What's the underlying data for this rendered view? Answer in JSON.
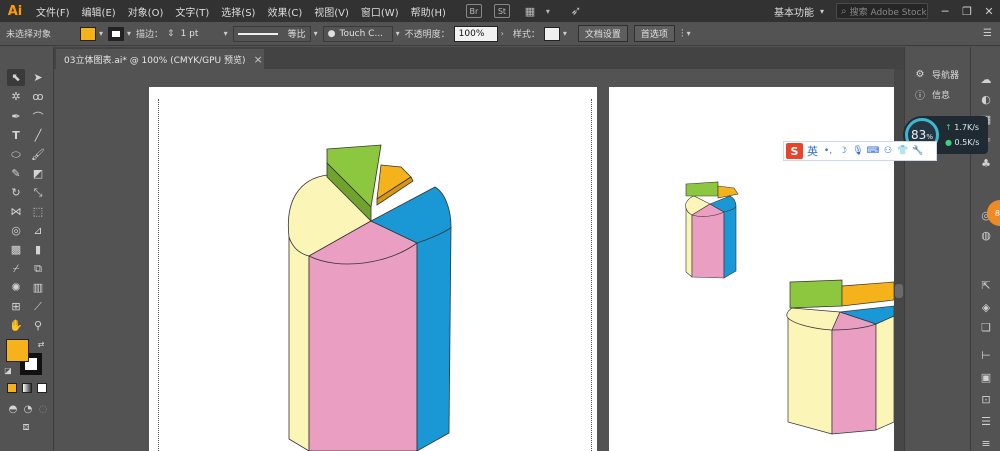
{
  "app": {
    "logo": "Ai"
  },
  "menu": [
    "文件(F)",
    "编辑(E)",
    "对象(O)",
    "文字(T)",
    "选择(S)",
    "效果(C)",
    "视图(V)",
    "窗口(W)",
    "帮助(H)"
  ],
  "menu_icons": {
    "bridge": "Br",
    "stock": "St"
  },
  "workspace": {
    "label": "基本功能",
    "search_placeholder": "搜索 Adobe Stock"
  },
  "control_bar": {
    "selection_status": "未选择对象",
    "fill_color": "#f5b21a",
    "stroke_label": "描边：",
    "stroke_weight": "1 pt",
    "profile": "等比",
    "brush": "Touch C...",
    "opacity_label": "不透明度：",
    "opacity_value": "100%",
    "style_label": "样式：",
    "doc_setup_button": "文档设置",
    "preferences_button": "首选项"
  },
  "document_tab": {
    "title": "03立体图表.ai* @ 100% (CMYK/GPU 预览)"
  },
  "panels": {
    "properties": "导航器",
    "info": "信息"
  },
  "net_monitor": {
    "percent": "83",
    "percent_unit": "%",
    "upload": "1.7K/s",
    "download": "0.5K/s",
    "badge": "83"
  },
  "ime": {
    "lang": "英"
  },
  "colors": {
    "accent": "#f5b21a",
    "green": "#8dc63f",
    "pink": "#ea9fc2",
    "blue": "#1a98d5",
    "cream": "#fbf5b8",
    "panel_bg": "#535353",
    "menu_bg": "#323232"
  }
}
